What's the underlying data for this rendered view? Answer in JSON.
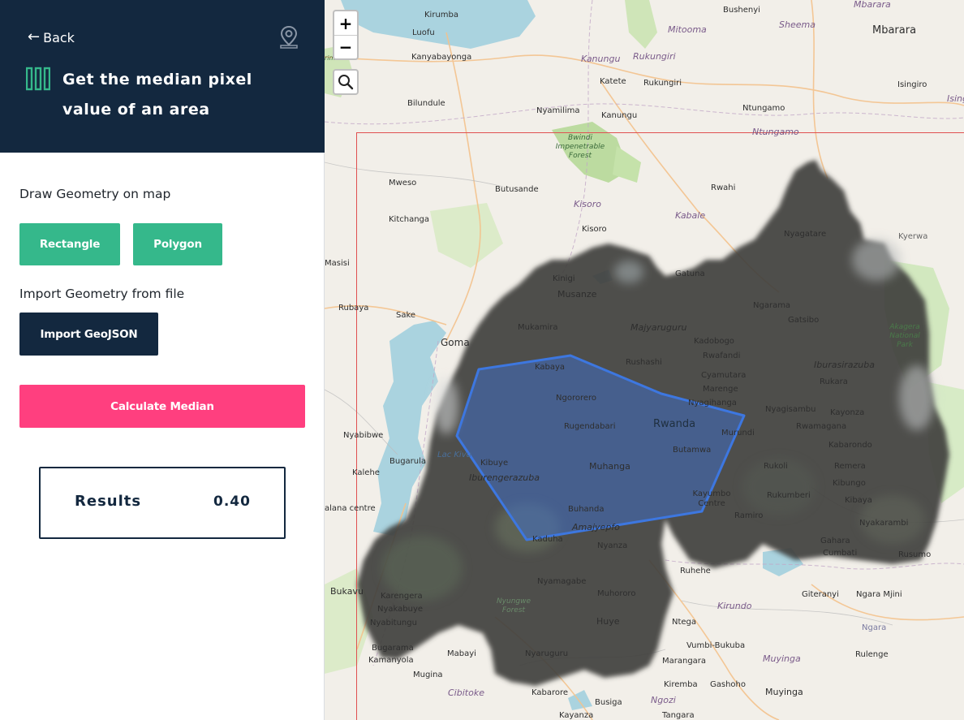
{
  "sidebar": {
    "back_label": "Back",
    "title": "Get the median pixel value of an area",
    "draw_label": "Draw Geometry on map",
    "rectangle_label": "Rectangle",
    "polygon_label": "Polygon",
    "import_label": "Import Geometry from file",
    "import_geojson_label": "Import GeoJSON",
    "calculate_label": "Calculate Median",
    "results_label": "Results",
    "results_value": "0.40"
  },
  "icons": {
    "back": "arrow-left-icon",
    "geo": "map-pin-icon",
    "title": "columns-icon",
    "search": "search-icon"
  },
  "colors": {
    "header_bg": "#13283f",
    "accent_green": "#35b88b",
    "accent_pink": "#ff3f7f",
    "navy": "#13283f",
    "polygon_fill": "#3d6fd0",
    "bbox_outline": "#e05050"
  },
  "map": {
    "zoom_in": "+",
    "zoom_out": "−",
    "labels": {
      "kirumba": "Kirumba",
      "bushenyi": "Bushenyi",
      "mbarara_r": "Mbarara",
      "mbarara": "Mbarara",
      "luofu": "Luofu",
      "mitooma": "Mitooma",
      "sheema": "Sheema",
      "kanyabayonga": "Kanyabayonga",
      "kanungu_r": "Kanungu",
      "rukungiri_r": "Rukungiri",
      "katete": "Katete",
      "rukungiri": "Rukungiri",
      "isingiro": "Isingiro",
      "isinge": "Isinge",
      "bilundule": "Bilundule",
      "nyamilima": "Nyamilima",
      "kanungu": "Kanungu",
      "ntungamo": "Ntungamo",
      "ntungamo_r": "Ntungamo",
      "bwindi": "Bwindi Impenetrable Forest",
      "mweso": "Mweso",
      "butusande": "Butusande",
      "rwahi": "Rwahi",
      "kitchanga": "Kitchanga",
      "kisoro_r": "Kisoro",
      "kabale_r": "Kabale",
      "kisoro": "Kisoro",
      "nyagatare": "Nyagatare",
      "kyerwa": "Kyerwa",
      "masisi": "Masisi",
      "kinigi": "Kinigi",
      "gatuna": "Gatuna",
      "musanze": "Musanze",
      "rubaya": "Rubaya",
      "ngarama": "Ngarama",
      "sake": "Sake",
      "gatsibo": "Gatsibo",
      "mukamira": "Mukamira",
      "majyaruguru": "Majyaruguru",
      "akagera": "Akagera National Park",
      "goma": "Goma",
      "kadobogo": "Kadobogo",
      "rwafandi": "Rwafandi",
      "rushashi": "Rushashi",
      "iburasirazuba": "Iburasirazuba",
      "kabaya": "Kabaya",
      "cyamutara": "Cyamutara",
      "rukara": "Rukara",
      "marenge": "Marenge",
      "nyagisambu": "Nyagisambu",
      "kayonza": "Kayonza",
      "ngororero": "Ngororero",
      "nyagihanga": "Nyagihanga",
      "rugendabari": "Rugendabari",
      "rwanda": "Rwanda",
      "murundi": "Murundi",
      "rwamagana": "Rwamagana",
      "nyabibwe": "Nyabibwe",
      "butamwa": "Butamwa",
      "kabarondo": "Kabarondo",
      "lac_kivu": "Lac Kivu",
      "bugarula": "Bugarula",
      "kibuye": "Kibuye",
      "muhanga": "Muhanga",
      "rukoli": "Rukoli",
      "remera": "Remera",
      "kalehe": "Kalehe",
      "iburengerazuba": "Iburengerazuba",
      "rukumberi": "Rukumberi",
      "kibungo": "Kibungo",
      "kayumbo": "Kayumbo Centre",
      "buhanda": "Buhanda",
      "ramiro": "Ramiro",
      "kibaya": "Kibaya",
      "kalana": "alana centre",
      "amajyepfo": "Amajyepfo",
      "nyakarambi": "Nyakarambi",
      "kaduha": "Kaduha",
      "gahara": "Gahara",
      "cumbati": "Cumbati",
      "nyanza": "Nyanza",
      "rusumo": "Rusumo",
      "ruhehe": "Ruhehe",
      "nyamagabe": "Nyamagabe",
      "bukavu": "Bukavu",
      "karengera": "Karengera",
      "muhororo": "Muhororo",
      "giteranyi": "Giteranyi",
      "ngara_mjini": "Ngara Mjini",
      "nyakabuye": "Nyakabuye",
      "nyungwe": "Nyungwe Forest",
      "kirundo": "Kirundo",
      "nyabitungu": "Nyabitungu",
      "huye": "Huye",
      "ntega": "Ntega",
      "ngara": "Ngara",
      "bugarama": "Bugarama",
      "mabayi": "Mabayi",
      "nyaruguru": "Nyaruguru",
      "vumbi": "Vumbi-Bukuba",
      "rulenge": "Rulenge",
      "kamanyola": "Kamanyola",
      "marangara": "Marangara",
      "muyinga_r": "Muyinga",
      "mugina": "Mugina",
      "kirembu": "Kiremba",
      "gashoho": "Gashoho",
      "cibitoke": "Cibitoke",
      "kabarore": "Kabarore",
      "muyinga": "Muyinga",
      "busiga": "Busiga",
      "ngozi": "Ngozi",
      "kayanza": "Kayanza",
      "tangara": "Tangara",
      "primates": "rimates"
    }
  }
}
